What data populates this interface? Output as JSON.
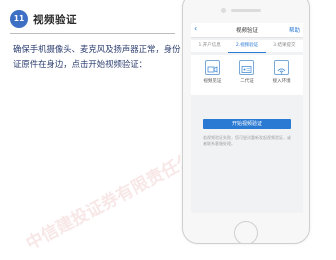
{
  "step": {
    "number": "11",
    "title": "视频验证"
  },
  "instruction": "确保手机摄像头、麦克风及扬声器正常，身份证原件在身边，点击开始视频验证：",
  "watermark": "中信建投证券有限责任公司",
  "phone": {
    "back_symbol": "‹",
    "screen_title": "视频验证",
    "header_action": "帮助",
    "progress_steps": [
      "1.开户信息",
      "2.视频验证",
      "3.结果提交"
    ],
    "icons": [
      {
        "name": "video-icon",
        "label": "视频见证"
      },
      {
        "name": "idcard-icon",
        "label": "二代证"
      },
      {
        "name": "network-icon",
        "label": "接入环境"
      }
    ],
    "start_button": "开始视频验证",
    "note": "若视频验证失败，您可尝试重新发起视频验证，或者联系客服处理。"
  },
  "colors": {
    "accent": "#2a7ad4",
    "badge": "#3d6fc4",
    "instruction_text": "#2c3e70"
  }
}
